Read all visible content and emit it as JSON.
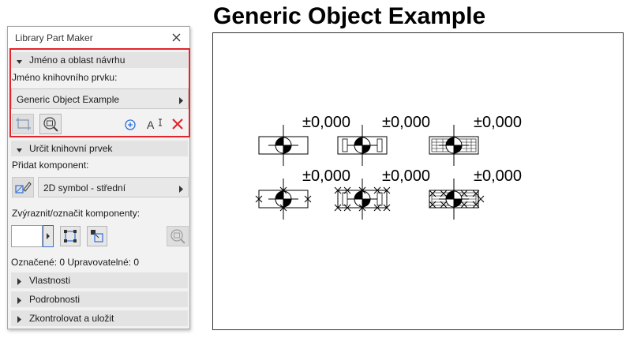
{
  "document_title": "Generic Object Example",
  "palette": {
    "title": "Library Part Maker",
    "section1": {
      "header": "Jméno a oblast návrhu",
      "name_label": "Jméno knihovního prvku:",
      "name_value": "Generic Object Example"
    },
    "section2": {
      "header": "Určit knihovní prvek",
      "add_component_label": "Přidat komponent:",
      "component_value": "2D symbol - střední",
      "highlight_label": "Zvýraznit/označit komponenty:",
      "status": "Označené: 0 Upravovatelné: 0"
    },
    "collapsed_sections": [
      "Vlastnosti",
      "Podrobnosti",
      "Zkontrolovat a uložit"
    ]
  },
  "canvas": {
    "elevation_labels": [
      "±0,000",
      "±0,000",
      "±0,000",
      "±0,000",
      "±0,000",
      "±0,000"
    ]
  },
  "colors": {
    "highlight_border": "#e0262b",
    "add_icon": "#2f6fd8",
    "delete_icon": "#e0262b",
    "section_header_bg": "#e3e3e3",
    "palette_bg": "#f2f2f2"
  },
  "icons": {
    "close": "close-icon",
    "expanded": "triangle-down-icon",
    "collapsed": "triangle-right-icon",
    "dropdown": "chevron-right-icon",
    "area": "selection-rectangle-icon",
    "zoom": "zoom-to-selection-icon",
    "add": "add-circle-icon",
    "text": "text-cursor-icon",
    "delete": "delete-x-icon",
    "symbol": "2d-symbol-icon"
  }
}
